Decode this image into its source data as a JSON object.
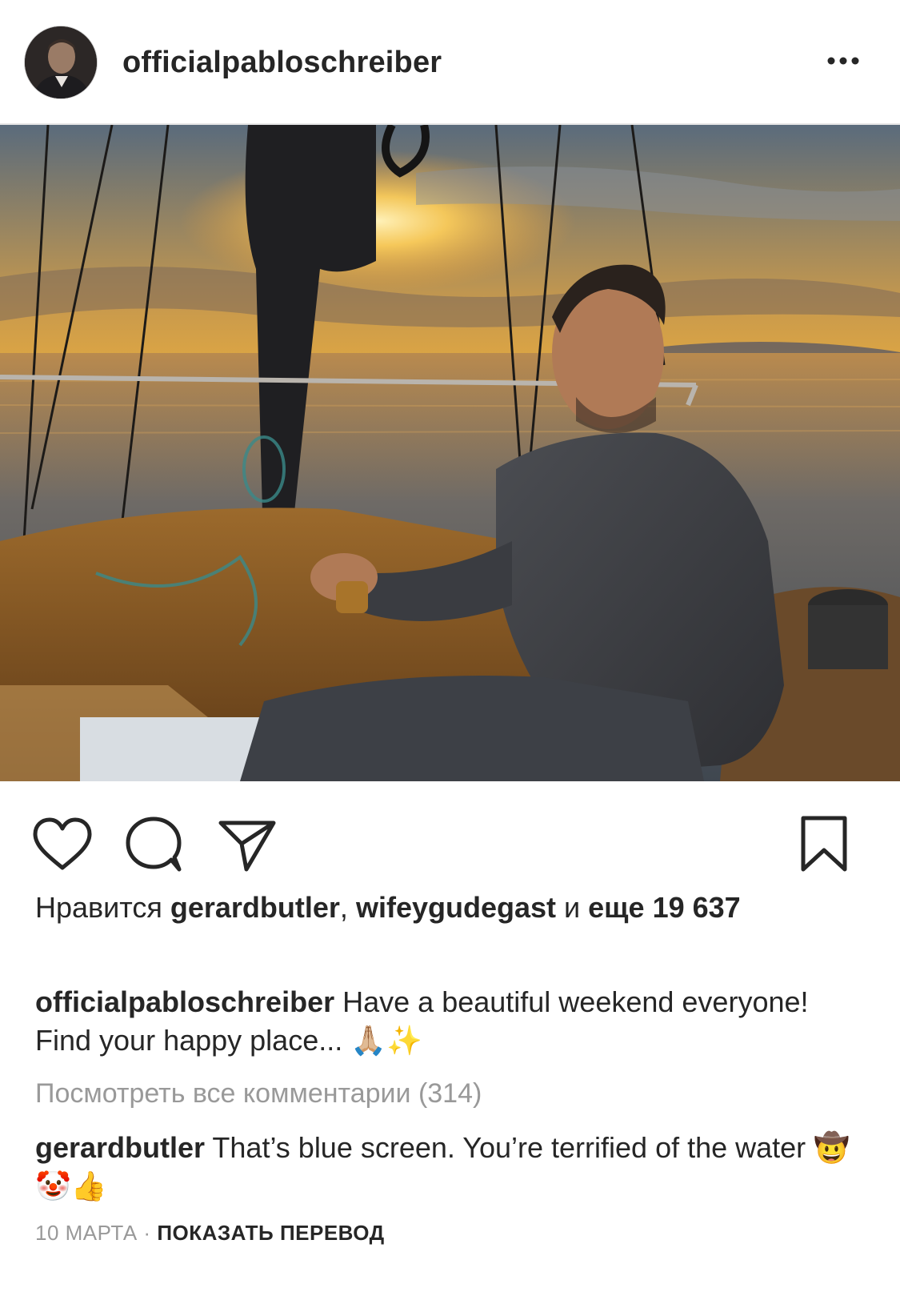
{
  "post": {
    "username": "officialpabloschreiber",
    "more_icon": "ellipsis-icon"
  },
  "actions": {
    "like_icon": "heart-icon",
    "comment_icon": "comment-icon",
    "share_icon": "paper-plane-icon",
    "save_icon": "bookmark-icon"
  },
  "likes": {
    "prefix": "Нравится",
    "user1": "gerardbutler",
    "separator": ",",
    "user2": "wifeygudegast",
    "conj": "и",
    "more_word": "еще",
    "count": "19 637"
  },
  "caption": {
    "username": "officialpabloschreiber",
    "text": "Have a beautiful weekend everyone!  Find your happy place... 🙏🏼✨"
  },
  "view_all_comments": "Посмотреть все комментарии (314)",
  "comment": {
    "username": "gerardbutler",
    "text": "That’s blue screen. You’re terrified of the water 🤠🤡👍"
  },
  "footer": {
    "date": "10 МАРТА",
    "dot": "·",
    "translate": "ПОКАЗАТЬ ПЕРЕВОД"
  }
}
